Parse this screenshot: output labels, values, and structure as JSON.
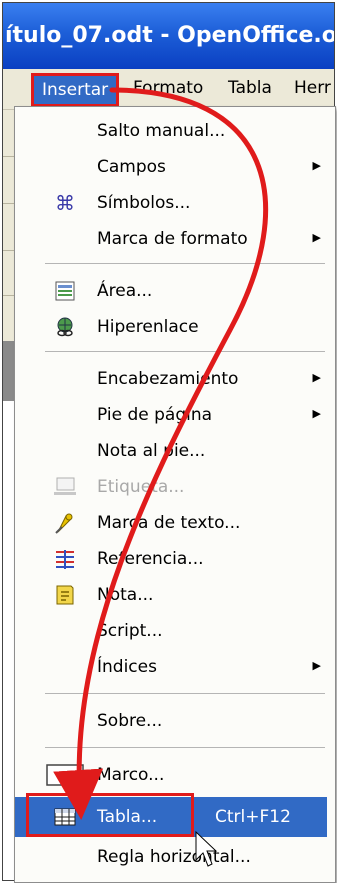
{
  "window": {
    "title": "ítulo_07.odt - OpenOffice.or"
  },
  "menubar": {
    "items": [
      {
        "label": "Insertar"
      },
      {
        "label": "Formato"
      },
      {
        "label": "Tabla"
      },
      {
        "label": "Herr"
      }
    ]
  },
  "menu": {
    "items": [
      {
        "label": "Salto manual...",
        "submenu": false
      },
      {
        "label": "Campos",
        "submenu": true
      },
      {
        "label": "Símbolos...",
        "icon": "command-symbol-icon",
        "submenu": false
      },
      {
        "label": "Marca de formato",
        "submenu": true
      },
      {
        "label": "Área...",
        "icon": "section-area-icon",
        "submenu": false
      },
      {
        "label": "Hiperenlace",
        "icon": "hyperlink-globe-icon",
        "submenu": false
      },
      {
        "label": "Encabezamiento",
        "submenu": true
      },
      {
        "label": "Pie de página",
        "submenu": true
      },
      {
        "label": "Nota al pie...",
        "submenu": false
      },
      {
        "label": "Etiqueta...",
        "icon": "caption-icon",
        "disabled": true,
        "submenu": false
      },
      {
        "label": "Marca de texto...",
        "icon": "bookmark-icon",
        "submenu": false
      },
      {
        "label": "Referencia...",
        "icon": "cross-reference-icon",
        "submenu": false
      },
      {
        "label": "Nota...",
        "icon": "note-icon",
        "submenu": false
      },
      {
        "label": "Script...",
        "submenu": false
      },
      {
        "label": "Índices",
        "submenu": true
      },
      {
        "label": "Sobre...",
        "submenu": false
      },
      {
        "label": "Marco...",
        "icon": "frame-icon",
        "submenu": false
      },
      {
        "label": "Tabla...",
        "icon": "table-icon",
        "shortcut": "Ctrl+F12",
        "highlighted": true,
        "submenu": false
      },
      {
        "label": "Regla horizontal...",
        "submenu": false
      }
    ]
  },
  "colors": {
    "highlight": "#316ac5",
    "annotation": "#e01b1b",
    "titlebar": "#1d5fd8"
  }
}
